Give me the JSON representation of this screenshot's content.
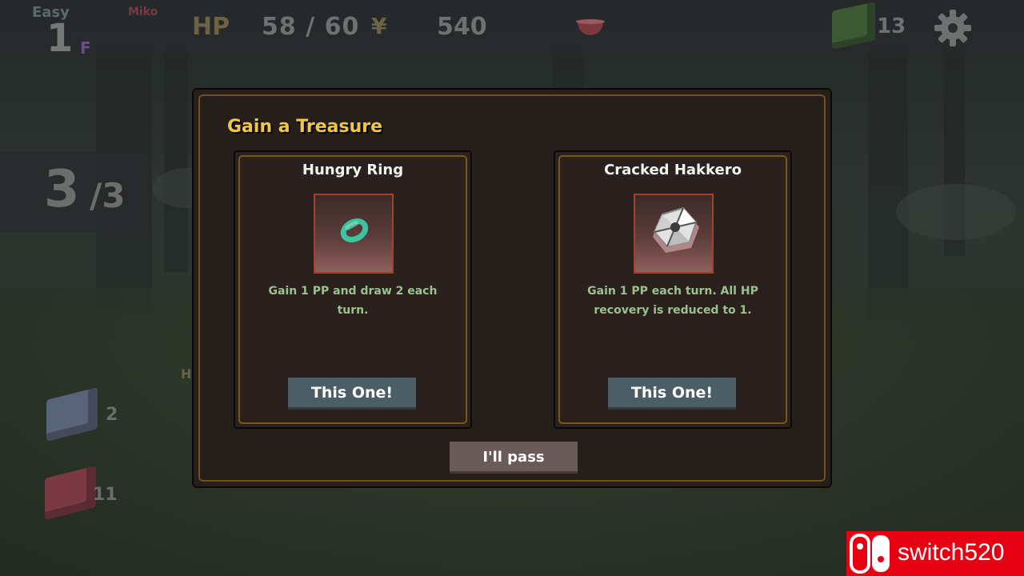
{
  "hud": {
    "difficulty": "Easy",
    "character": "Miko",
    "floor": "1",
    "floor_unit": "F",
    "hp_label": "HP",
    "hp_value": "58 / 60",
    "currency_symbol": "¥",
    "money": "540",
    "deck_count": "13"
  },
  "side": {
    "turn_current": "3",
    "turn_max": "/3",
    "draw_pile_count": "2",
    "discard_pile_count": "11",
    "h_fragment": "H"
  },
  "modal": {
    "title": "Gain a Treasure",
    "options": [
      {
        "name": "Hungry Ring",
        "icon": "ring-icon",
        "description": "Gain 1 PP and draw 2 each turn.",
        "button": "This One!"
      },
      {
        "name": "Cracked Hakkero",
        "icon": "hakkero-icon",
        "description": "Gain 1 PP each turn. All HP recovery is reduced to 1.",
        "button": "This One!"
      }
    ],
    "pass_button": "I'll pass"
  },
  "watermark": {
    "text": "switch520"
  },
  "colors": {
    "title": "#f0c64a",
    "description": "#9bc18f",
    "pick_button": "#4c5e65",
    "pass_button": "#6b5b58",
    "frame_border": "#6e4f1e"
  }
}
